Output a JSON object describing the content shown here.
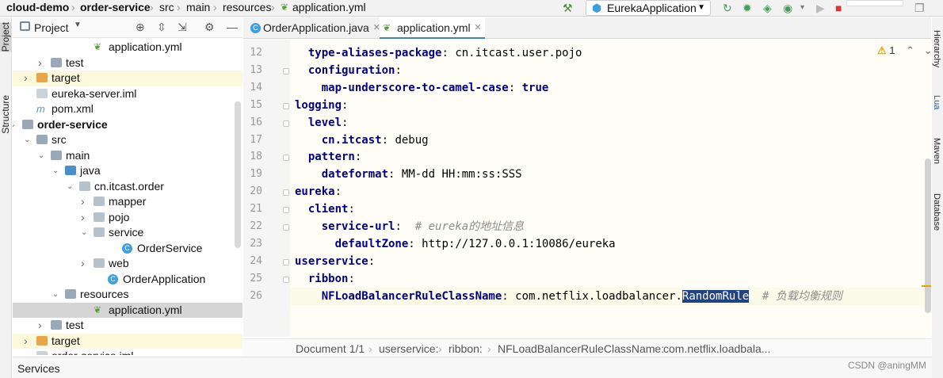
{
  "nav": {
    "breadcrumbs": [
      "cloud-demo",
      "order-service",
      "src",
      "main",
      "resources",
      "application.yml"
    ],
    "run_config": "EurekaApplication"
  },
  "left_tools": {
    "project": "Project",
    "structure": "Structure"
  },
  "right_tools": {
    "hierarchy": "Hierarchy",
    "lua": "Lua",
    "maven": "Maven",
    "database": "Database"
  },
  "project_panel": {
    "title": "Project",
    "tree": [
      {
        "label": "application.yml",
        "type": "yml",
        "depth": 6,
        "arrow": ""
      },
      {
        "label": "test",
        "type": "folder",
        "depth": 3,
        "arrow": "right"
      },
      {
        "label": "target",
        "type": "target",
        "depth": 2,
        "arrow": "right"
      },
      {
        "label": "eureka-server.iml",
        "type": "iml",
        "depth": 2,
        "arrow": ""
      },
      {
        "label": "pom.xml",
        "type": "pom",
        "depth": 2,
        "arrow": ""
      },
      {
        "label": "order-service",
        "type": "module",
        "depth": 1,
        "arrow": "down"
      },
      {
        "label": "src",
        "type": "folder",
        "depth": 2,
        "arrow": "down"
      },
      {
        "label": "main",
        "type": "folder",
        "depth": 3,
        "arrow": "down"
      },
      {
        "label": "java",
        "type": "src",
        "depth": 4,
        "arrow": "down"
      },
      {
        "label": "cn.itcast.order",
        "type": "package",
        "depth": 5,
        "arrow": "down"
      },
      {
        "label": "mapper",
        "type": "package",
        "depth": 6,
        "arrow": "right"
      },
      {
        "label": "pojo",
        "type": "package",
        "depth": 6,
        "arrow": "right"
      },
      {
        "label": "service",
        "type": "package",
        "depth": 6,
        "arrow": "down"
      },
      {
        "label": "OrderService",
        "type": "class",
        "depth": 8,
        "arrow": ""
      },
      {
        "label": "web",
        "type": "package",
        "depth": 6,
        "arrow": "right"
      },
      {
        "label": "OrderApplication",
        "type": "class",
        "depth": 7,
        "arrow": ""
      },
      {
        "label": "resources",
        "type": "resfolder",
        "depth": 4,
        "arrow": "down"
      },
      {
        "label": "application.yml",
        "type": "yml",
        "depth": 6,
        "arrow": ""
      },
      {
        "label": "test",
        "type": "folder",
        "depth": 3,
        "arrow": "right"
      },
      {
        "label": "target",
        "type": "target",
        "depth": 2,
        "arrow": "right"
      },
      {
        "label": "order-service.iml",
        "type": "iml",
        "depth": 2,
        "arrow": ""
      }
    ]
  },
  "tabs": [
    {
      "label": "OrderApplication.java",
      "active": false
    },
    {
      "label": "application.yml",
      "active": true
    }
  ],
  "editor": {
    "warning_count": "1",
    "lines": [
      {
        "n": "12",
        "indent": "  ",
        "key": "type-aliases-package",
        "value": "cn.itcast.user.pojo",
        "comment": ""
      },
      {
        "n": "13",
        "indent": "  ",
        "key": "configuration",
        "value": "",
        "comment": ""
      },
      {
        "n": "14",
        "indent": "    ",
        "key": "map-underscore-to-camel-case",
        "value": "true",
        "comment": ""
      },
      {
        "n": "15",
        "indent": "",
        "key": "logging",
        "value": "",
        "comment": ""
      },
      {
        "n": "16",
        "indent": "  ",
        "key": "level",
        "value": "",
        "comment": ""
      },
      {
        "n": "17",
        "indent": "    ",
        "key": "cn.itcast",
        "value": "debug",
        "comment": ""
      },
      {
        "n": "18",
        "indent": "  ",
        "key": "pattern",
        "value": "",
        "comment": ""
      },
      {
        "n": "19",
        "indent": "    ",
        "key": "dateformat",
        "value": "MM-dd HH:mm:ss:SSS",
        "comment": ""
      },
      {
        "n": "20",
        "indent": "",
        "key": "eureka",
        "value": "",
        "comment": ""
      },
      {
        "n": "21",
        "indent": "  ",
        "key": "client",
        "value": "",
        "comment": ""
      },
      {
        "n": "22",
        "indent": "    ",
        "key": "service-url",
        "value": "",
        "comment": "# eureka的地址信息"
      },
      {
        "n": "23",
        "indent": "      ",
        "key": "defaultZone",
        "value": "http://127.0.0.1:10086/eureka",
        "comment": ""
      },
      {
        "n": "24",
        "indent": "",
        "key": "userservice",
        "value": "",
        "comment": ""
      },
      {
        "n": "25",
        "indent": "  ",
        "key": "ribbon",
        "value": "",
        "comment": ""
      },
      {
        "n": "26",
        "indent": "    ",
        "key": "NFLoadBalancerRuleClassName",
        "value": "com.netflix.loadbalancer.",
        "selected": "RandomRule",
        "comment": "# 负载均衡规则"
      }
    ]
  },
  "status_breadcrumb": [
    "Document 1/1",
    "userservice:",
    "ribbon:",
    "NFLoadBalancerRuleClassName:",
    "com.netflix.loadbala..."
  ],
  "bottom": {
    "services": "Services"
  },
  "watermark": "CSDN @aningMM"
}
